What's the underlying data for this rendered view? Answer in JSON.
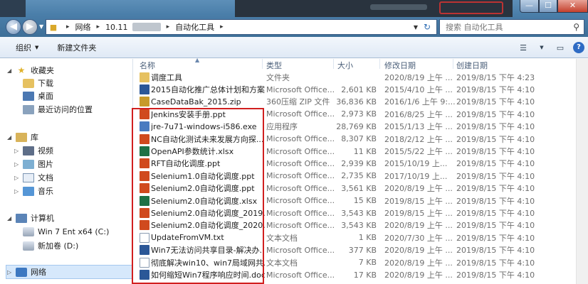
{
  "window": {
    "min_icon": "minimize-icon",
    "max_icon": "maximize-icon",
    "close_icon": "close-icon",
    "min_glyph": "—",
    "max_glyph": "☐",
    "close_glyph": "✕"
  },
  "address": {
    "crumbs": [
      "网络",
      "10.11",
      "自动化工具"
    ],
    "separator": "▸",
    "search_placeholder": "搜索 自动化工具"
  },
  "toolbar": {
    "organize": "组织",
    "new_folder": "新建文件夹"
  },
  "nav": {
    "favorites": "收藏夹",
    "downloads": "下载",
    "desktop": "桌面",
    "recent": "最近访问的位置",
    "libraries": "库",
    "videos": "视频",
    "pictures": "图片",
    "documents": "文档",
    "music": "音乐",
    "computer": "计算机",
    "drive_c": "Win 7 Ent x64 (C:)",
    "drive_d": "新加卷 (D:)",
    "network": "网络"
  },
  "columns": {
    "name": "名称",
    "type": "类型",
    "size": "大小",
    "modified": "修改日期",
    "created": "创建日期"
  },
  "files": [
    {
      "name": "调度工具",
      "type": "文件夹",
      "size": "",
      "modified": "2020/8/19 上午 ...",
      "created": "2019/8/15 下午 4:23",
      "kind": "folder"
    },
    {
      "name": "2015自动化推广总体计划和方案...",
      "type": "Microsoft Office...",
      "size": "2,601 KB",
      "modified": "2015/4/10 上午 ...",
      "created": "2019/8/15 下午 4:10",
      "kind": "doc"
    },
    {
      "name": "CaseDataBak_2015.zip",
      "type": "360压缩 ZIP 文件",
      "size": "36,836 KB",
      "modified": "2016/1/6 上午 9:...",
      "created": "2019/8/15 下午 4:10",
      "kind": "zip"
    },
    {
      "name": "Jenkins安装手册.ppt",
      "type": "Microsoft Office...",
      "size": "2,973 KB",
      "modified": "2016/8/25 上午 ...",
      "created": "2019/8/15 下午 4:10",
      "kind": "ppt"
    },
    {
      "name": "jre-7u71-windows-i586.exe",
      "type": "应用程序",
      "size": "28,769 KB",
      "modified": "2015/1/13 上午 ...",
      "created": "2019/8/15 下午 4:10",
      "kind": "exe"
    },
    {
      "name": "NC自动化测试未来发展方向探...",
      "type": "Microsoft Office...",
      "size": "8,307 KB",
      "modified": "2018/2/12 上午 ...",
      "created": "2019/8/15 下午 4:10",
      "kind": "ppt"
    },
    {
      "name": "OpenAPI参数统计.xlsx",
      "type": "Microsoft Office...",
      "size": "11 KB",
      "modified": "2015/5/22 上午 ...",
      "created": "2019/8/15 下午 4:10",
      "kind": "xls"
    },
    {
      "name": "RFT自动化调度.ppt",
      "type": "Microsoft Office...",
      "size": "2,939 KB",
      "modified": "2015/10/19 上...",
      "created": "2019/8/15 下午 4:10",
      "kind": "ppt"
    },
    {
      "name": "Selenium1.0自动化调度.ppt",
      "type": "Microsoft Office...",
      "size": "2,735 KB",
      "modified": "2017/10/19 上...",
      "created": "2019/8/15 下午 4:10",
      "kind": "ppt"
    },
    {
      "name": "Selenium2.0自动化调度.ppt",
      "type": "Microsoft Office...",
      "size": "3,561 KB",
      "modified": "2020/8/19 上午 ...",
      "created": "2019/8/15 下午 4:10",
      "kind": "ppt"
    },
    {
      "name": "Selenium2.0自动化调度.xlsx",
      "type": "Microsoft Office...",
      "size": "15 KB",
      "modified": "2019/8/15 上午 ...",
      "created": "2019/8/15 下午 4:10",
      "kind": "xls"
    },
    {
      "name": "Selenium2.0自动化调度_2019.p...",
      "type": "Microsoft Office...",
      "size": "3,543 KB",
      "modified": "2019/8/15 上午 ...",
      "created": "2019/8/15 下午 4:10",
      "kind": "ppt"
    },
    {
      "name": "Selenium2.0自动化调度_2020.p...",
      "type": "Microsoft Office...",
      "size": "3,543 KB",
      "modified": "2020/8/19 上午 ...",
      "created": "2019/8/15 下午 4:10",
      "kind": "ppt"
    },
    {
      "name": "UpdateFromVM.txt",
      "type": "文本文档",
      "size": "1 KB",
      "modified": "2020/7/30 上午 ...",
      "created": "2019/8/15 下午 4:10",
      "kind": "txt"
    },
    {
      "name": "Win7无法访问共享目录-解决办...",
      "type": "Microsoft Office...",
      "size": "377 KB",
      "modified": "2020/8/19 上午 ...",
      "created": "2019/8/15 下午 4:10",
      "kind": "doc"
    },
    {
      "name": "彻底解决win10、win7局域网共...",
      "type": "文本文档",
      "size": "7 KB",
      "modified": "2020/8/19 上午 ...",
      "created": "2019/8/15 下午 4:10",
      "kind": "txt"
    },
    {
      "name": "如何缩短Win7程序响应时间.docx",
      "type": "Microsoft Office...",
      "size": "17 KB",
      "modified": "2020/8/19 上午 ...",
      "created": "2019/8/15 下午 4:10",
      "kind": "doc"
    }
  ],
  "colors": {
    "highlight_box": "#d11f1f",
    "title_bar": "#4a7ea9"
  }
}
